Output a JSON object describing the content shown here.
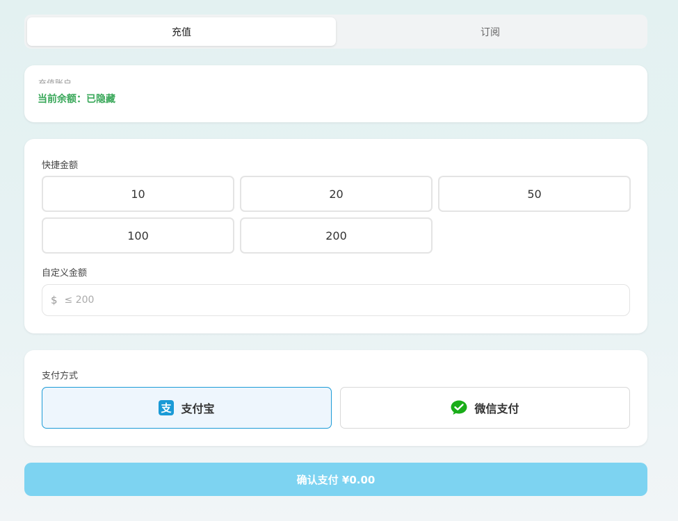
{
  "tabs": [
    {
      "label": "充值",
      "active": true
    },
    {
      "label": "订阅",
      "active": false
    }
  ],
  "account": {
    "label": "充值账户",
    "balance_text": "当前余额：已隐藏"
  },
  "amount": {
    "quick_label": "快捷金额",
    "quick_options": [
      "10",
      "20",
      "50",
      "100",
      "200"
    ],
    "custom_label": "自定义金额",
    "currency_symbol": "$",
    "custom_placeholder": "≤ 200",
    "custom_value": ""
  },
  "payment": {
    "label": "支付方式",
    "methods": [
      {
        "label": "支付宝",
        "icon": "alipay-icon",
        "selected": true
      },
      {
        "label": "微信支付",
        "icon": "wechat-pay-icon",
        "selected": false
      }
    ]
  },
  "confirm": {
    "label": "确认支付 ¥0.00"
  },
  "colors": {
    "accent": "#1a9ad6",
    "confirm_bg": "#7dd3f1",
    "balance_green": "#3aa85a",
    "alipay_blue": "#1a9ad6",
    "wechat_green": "#1aad19"
  }
}
